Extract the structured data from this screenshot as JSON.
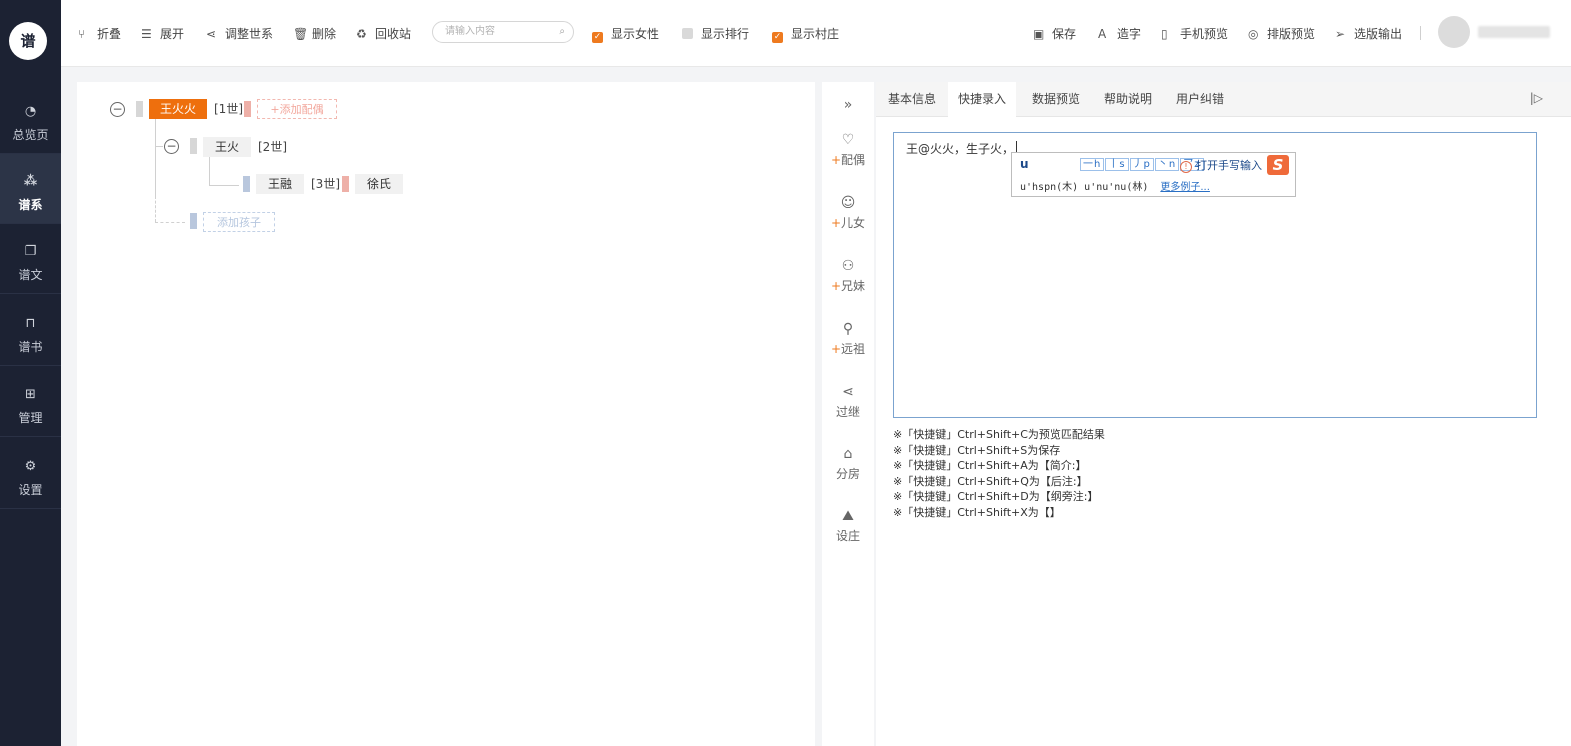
{
  "sidebar": {
    "logo": "谱",
    "items": [
      {
        "label": "总览页",
        "icon": "pie-chart-icon"
      },
      {
        "label": "谱系",
        "icon": "tree-icon"
      },
      {
        "label": "谱文",
        "icon": "document-icon"
      },
      {
        "label": "谱书",
        "icon": "book-icon"
      },
      {
        "label": "管理",
        "icon": "grid-icon"
      },
      {
        "label": "设置",
        "icon": "gear-icon"
      }
    ]
  },
  "toolbar": {
    "collapse": "折叠",
    "expand": "展开",
    "adjust_generation": "调整世系",
    "delete": "删除",
    "recycle_bin": "回收站",
    "search_placeholder": "请输入内容",
    "show_female": "显示女性",
    "show_rank": "显示排行",
    "show_village": "显示村庄",
    "save": "保存",
    "create_char": "造字",
    "mobile_preview": "手机预览",
    "layout_preview": "排版预览",
    "select_output": "选版输出"
  },
  "tree": {
    "root": {
      "name": "王火火",
      "gen": "[1世]",
      "add_spouse": "+添加配偶"
    },
    "child": {
      "name": "王火",
      "gen": "[2世]"
    },
    "grandchild": {
      "name": "王融",
      "gen": "[3世]",
      "spouse": "徐氏"
    },
    "add_child": "添加孩子"
  },
  "tools": [
    {
      "label": "配偶",
      "plus": "+",
      "icon": "spouse-icon"
    },
    {
      "label": "儿女",
      "plus": "+",
      "icon": "child-icon"
    },
    {
      "label": "兄妹",
      "plus": "+",
      "icon": "siblings-icon"
    },
    {
      "label": "远祖",
      "plus": "+",
      "icon": "ancestor-icon"
    },
    {
      "label": "过继",
      "plus": "",
      "icon": "share-icon"
    },
    {
      "label": "分房",
      "plus": "",
      "icon": "house-icon"
    },
    {
      "label": "设庄",
      "plus": "",
      "icon": "mountain-icon"
    }
  ],
  "tabs": [
    "基本信息",
    "快捷录入",
    "数据预览",
    "帮助说明",
    "用户纠错"
  ],
  "editor": {
    "text": "王@火火，生子火，"
  },
  "ime": {
    "input": "u",
    "tones": [
      "一h",
      "丨s",
      "丿p",
      "丶n",
      "乛z"
    ],
    "handwriting": "打开手写输入",
    "examples": "u'hspn(木)  u'nu'nu(林)",
    "more": "更多例子..."
  },
  "hints": [
    "※「快捷键」Ctrl+Shift+C为预览匹配结果",
    "※「快捷键」Ctrl+Shift+S为保存",
    "※「快捷键」Ctrl+Shift+A为【简介:】",
    "※「快捷键」Ctrl+Shift+Q为【后注:】",
    "※「快捷键」Ctrl+Shift+D为【纲旁注:】",
    "※「快捷键」Ctrl+Shift+X为【】"
  ],
  "colors": {
    "accent": "#ee6f0d",
    "sidebar_bg": "#1c2233",
    "editor_border": "#7ba3cf"
  }
}
